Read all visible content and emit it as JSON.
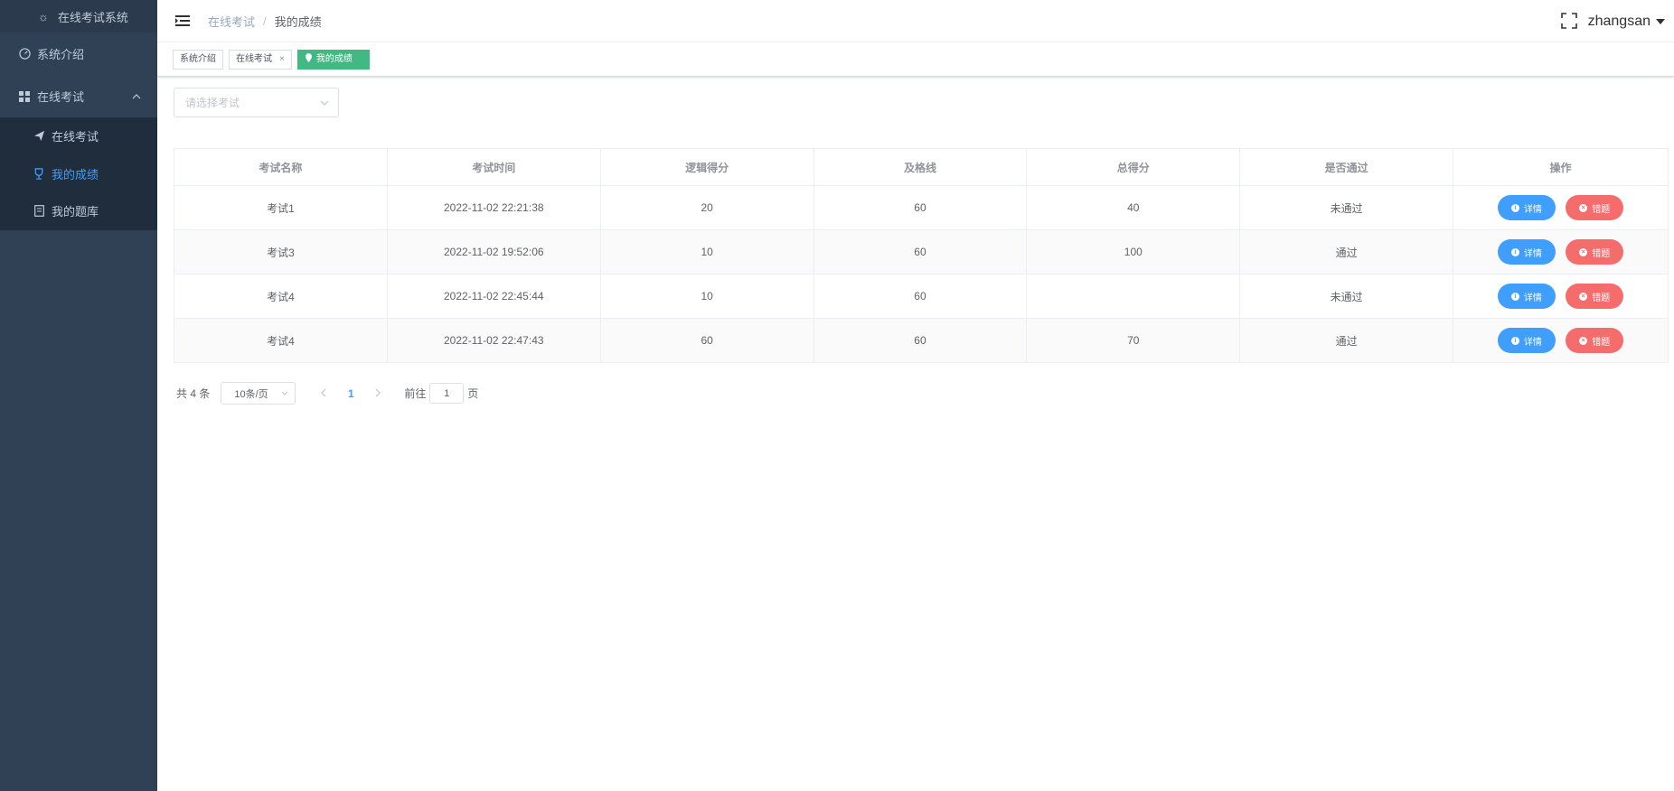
{
  "sidebar": {
    "brand": "在线考试系统",
    "items": [
      {
        "label": "系统介绍",
        "icon": "dashboard-icon"
      },
      {
        "label": "在线考试",
        "icon": "grid-icon",
        "expanded": true
      },
      {
        "label": "在线考试",
        "icon": "paper-plane-icon"
      },
      {
        "label": "我的成绩",
        "icon": "trophy-icon",
        "active": true
      },
      {
        "label": "我的题库",
        "icon": "book-icon"
      }
    ]
  },
  "navbar": {
    "breadcrumb": [
      "在线考试",
      "我的成绩"
    ],
    "separator": "/",
    "username": "zhangsan"
  },
  "tags": [
    {
      "label": "系统介绍"
    },
    {
      "label": "在线考试",
      "closable": true,
      "close": "×"
    },
    {
      "label": "我的成绩",
      "active": true
    }
  ],
  "filter": {
    "placeholder": "请选择考试"
  },
  "table": {
    "headers": [
      "考试名称",
      "考试时间",
      "逻辑得分",
      "及格线",
      "总得分",
      "是否通过",
      "操作"
    ],
    "rows": [
      {
        "name": "考试1",
        "time": "2022-11-02 22:21:38",
        "logic": "20",
        "passline": "60",
        "total": "40",
        "passed": "未通过",
        "ok": false
      },
      {
        "name": "考试3",
        "time": "2022-11-02 19:52:06",
        "logic": "10",
        "passline": "60",
        "total": "100",
        "passed": "通过",
        "ok": true
      },
      {
        "name": "考试4",
        "time": "2022-11-02 22:45:44",
        "logic": "10",
        "passline": "60",
        "total": "",
        "passed": "未通过",
        "ok": false
      },
      {
        "name": "考试4",
        "time": "2022-11-02 22:47:43",
        "logic": "60",
        "passline": "60",
        "total": "70",
        "passed": "通过",
        "ok": true
      }
    ],
    "actions": {
      "detail": "详情",
      "wrong": "错题"
    }
  },
  "pagination": {
    "total": "共 4 条",
    "page_size": "10条/页",
    "current": "1",
    "goto_prefix": "前往",
    "goto_value": "1",
    "goto_suffix": "页"
  },
  "colors": {
    "sidebar": "#304156",
    "accent": "#409eff",
    "tag_active": "#42b983",
    "danger": "#f56c6c",
    "success": "#67c23a"
  }
}
